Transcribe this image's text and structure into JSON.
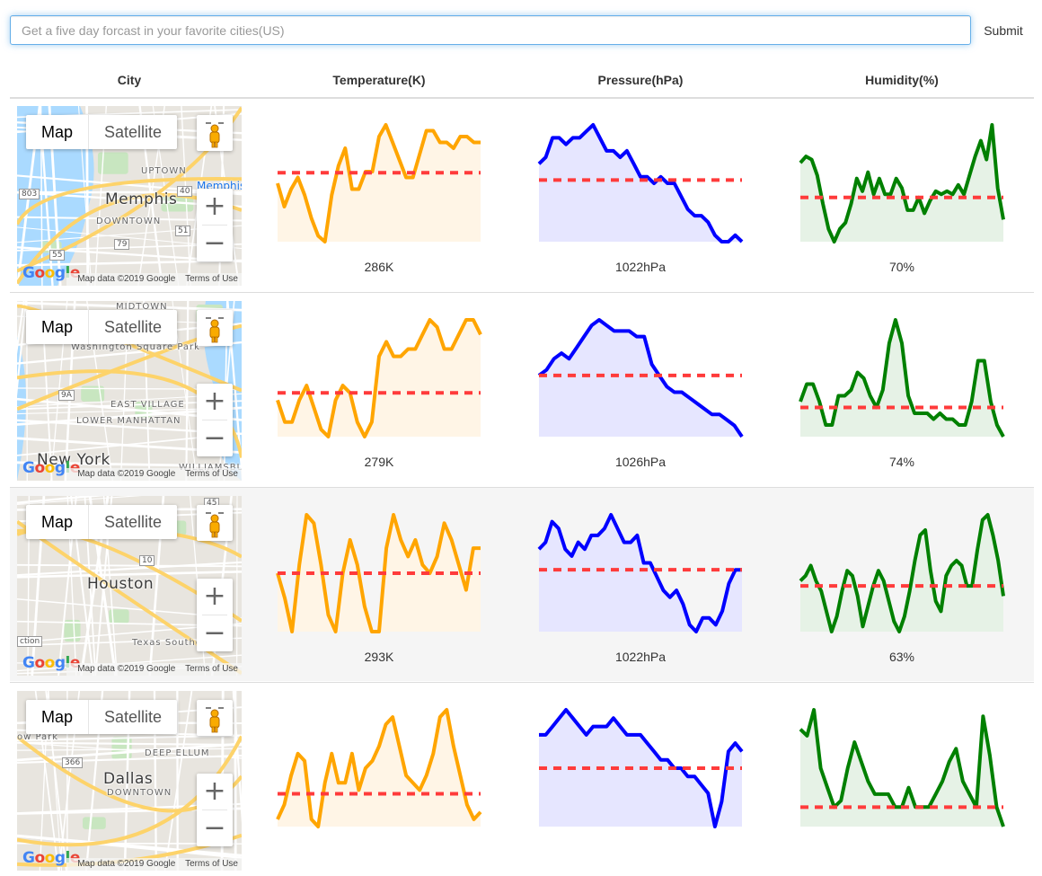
{
  "search": {
    "placeholder": "Get a five day forcast in your favorite cities(US)",
    "submit_label": "Submit"
  },
  "table": {
    "headers": [
      "City",
      "Temperature(K)",
      "Pressure(hPa)",
      "Humidity(%)"
    ]
  },
  "map_controls": {
    "map_label": "Map",
    "satellite_label": "Satellite",
    "zoom_in": "+",
    "zoom_out": "−",
    "logo_letters": [
      "G",
      "o",
      "o",
      "g",
      "l",
      "e"
    ],
    "attribution": "Map data ©2019 Google",
    "terms": "Terms of Use"
  },
  "colors": {
    "temperature": "#ffa500",
    "temperature_fill": "#fff5e6",
    "pressure": "#0000ff",
    "pressure_fill": "#e6e6ff",
    "humidity": "#008000",
    "humidity_fill": "#e6f2e6",
    "reference_line": "#ff3b3b"
  },
  "rows": [
    {
      "city": "Memphis",
      "map_labels": [
        "Memphis",
        "UPTOWN",
        "DOWNTOWN",
        "Memphis",
        "803",
        "40",
        "51",
        "79",
        "55"
      ],
      "temperature_value": "286K",
      "pressure_value": "1022hPa",
      "humidity_value": "70%",
      "temperature_series": [
        282,
        278,
        281,
        283,
        280,
        276,
        273,
        272,
        280,
        285,
        288,
        281,
        281,
        284,
        284,
        290,
        292,
        289,
        286,
        283,
        283,
        287,
        291,
        291,
        289,
        289,
        288,
        290,
        290,
        289,
        289
      ],
      "temperature_mean": 283.8,
      "pressure_series": [
        1025,
        1026,
        1029,
        1029,
        1028,
        1029,
        1029,
        1030,
        1031,
        1029,
        1027,
        1027,
        1026,
        1027,
        1025,
        1023,
        1023,
        1022,
        1023,
        1022,
        1022,
        1020,
        1018,
        1017,
        1017,
        1016,
        1014,
        1013,
        1013,
        1014,
        1013
      ],
      "pressure_mean": 1022.5,
      "humidity_series": [
        76,
        78,
        77,
        72,
        63,
        55,
        51,
        55,
        57,
        63,
        71,
        67,
        73,
        66,
        71,
        66,
        66,
        71,
        68,
        61,
        61,
        65,
        60,
        64,
        67,
        66,
        67,
        66,
        69,
        66,
        72,
        78,
        83,
        77,
        88,
        68,
        58
      ],
      "humidity_mean": 65
    },
    {
      "city": "New York",
      "map_labels": [
        "New York",
        "Washington Square Park",
        "EAST VILLAGE",
        "LOWER MANHATTAN",
        "MIDTOWN",
        "WILLIAMSBURG",
        "9A"
      ],
      "temperature_value": "279K",
      "pressure_value": "1026hPa",
      "humidity_value": "74%",
      "temperature_series": [
        276,
        273,
        273,
        276,
        278,
        275,
        272,
        271,
        276,
        278,
        277,
        273,
        271,
        273,
        282,
        284,
        282,
        282,
        283,
        283,
        285,
        287,
        286,
        283,
        283,
        285,
        287,
        287,
        285
      ],
      "temperature_mean": 277,
      "pressure_series": [
        1023,
        1024,
        1026,
        1027,
        1026,
        1028,
        1030,
        1032,
        1033,
        1032,
        1031,
        1031,
        1031,
        1030,
        1030,
        1025,
        1023,
        1021,
        1020,
        1020,
        1019,
        1018,
        1017,
        1016,
        1016,
        1015,
        1014,
        1012
      ],
      "pressure_mean": 1023,
      "humidity_series": [
        72,
        75,
        75,
        72,
        68,
        68,
        73,
        73,
        74,
        77,
        76,
        73,
        71,
        74,
        82,
        86,
        82,
        73,
        70,
        70,
        70,
        69,
        70,
        69,
        69,
        68,
        68,
        72,
        79,
        79,
        72,
        68,
        66
      ],
      "humidity_mean": 71
    },
    {
      "city": "Houston",
      "map_labels": [
        "Houston",
        "Texas Southern",
        "ction",
        "10",
        "45"
      ],
      "temperature_value": "293K",
      "pressure_value": "1022hPa",
      "humidity_value": "63%",
      "temperature_series": [
        289,
        286,
        282,
        290,
        296,
        295,
        290,
        284,
        282,
        289,
        293,
        290,
        285,
        282,
        282,
        292,
        296,
        293,
        291,
        293,
        290,
        289,
        291,
        295,
        293,
        290,
        287,
        292,
        292
      ],
      "temperature_mean": 289,
      "pressure_series": [
        1023,
        1024,
        1027,
        1026,
        1023,
        1022,
        1024,
        1023,
        1025,
        1025,
        1026,
        1028,
        1026,
        1024,
        1024,
        1025,
        1021,
        1021,
        1019,
        1017,
        1016,
        1017,
        1015,
        1012,
        1011,
        1013,
        1013,
        1012,
        1014,
        1018,
        1020,
        1020
      ],
      "pressure_mean": 1020,
      "humidity_series": [
        61,
        62,
        64,
        61,
        59,
        55,
        51,
        54,
        59,
        63,
        62,
        58,
        52,
        56,
        60,
        63,
        61,
        57,
        53,
        51,
        54,
        59,
        65,
        70,
        71,
        63,
        57,
        55,
        62,
        64,
        65,
        64,
        60,
        60,
        67,
        73,
        74,
        70,
        65,
        58
      ],
      "humidity_mean": 60
    },
    {
      "city": "Dallas",
      "map_labels": [
        "Dallas",
        "DEEP ELLUM",
        "DOWNTOWN",
        "ow Park",
        "366"
      ],
      "temperature_value": "",
      "pressure_value": "",
      "humidity_value": "",
      "temperature_series": [
        280,
        282,
        286,
        289,
        288,
        280,
        279,
        285,
        289,
        285,
        285,
        289,
        284,
        287,
        288,
        290,
        293,
        294,
        290,
        286,
        285,
        284,
        286,
        289,
        294,
        295,
        290,
        286,
        282,
        280,
        281
      ],
      "temperature_mean": 283.5,
      "pressure_series": [
        1030,
        1030,
        1031,
        1032,
        1033,
        1032,
        1031,
        1030,
        1031,
        1031,
        1031,
        1032,
        1031,
        1030,
        1030,
        1030,
        1029,
        1028,
        1027,
        1027,
        1026,
        1026,
        1025,
        1025,
        1024,
        1023,
        1019,
        1022,
        1028,
        1029,
        1028
      ],
      "pressure_mean": 1026,
      "humidity_series": [
        68,
        67,
        71,
        62,
        59,
        56,
        57,
        62,
        66,
        63,
        60,
        58,
        58,
        58,
        56,
        56,
        59,
        56,
        56,
        56,
        58,
        60,
        63,
        65,
        60,
        58,
        56,
        70,
        64,
        56,
        53
      ],
      "humidity_mean": 56
    }
  ]
}
